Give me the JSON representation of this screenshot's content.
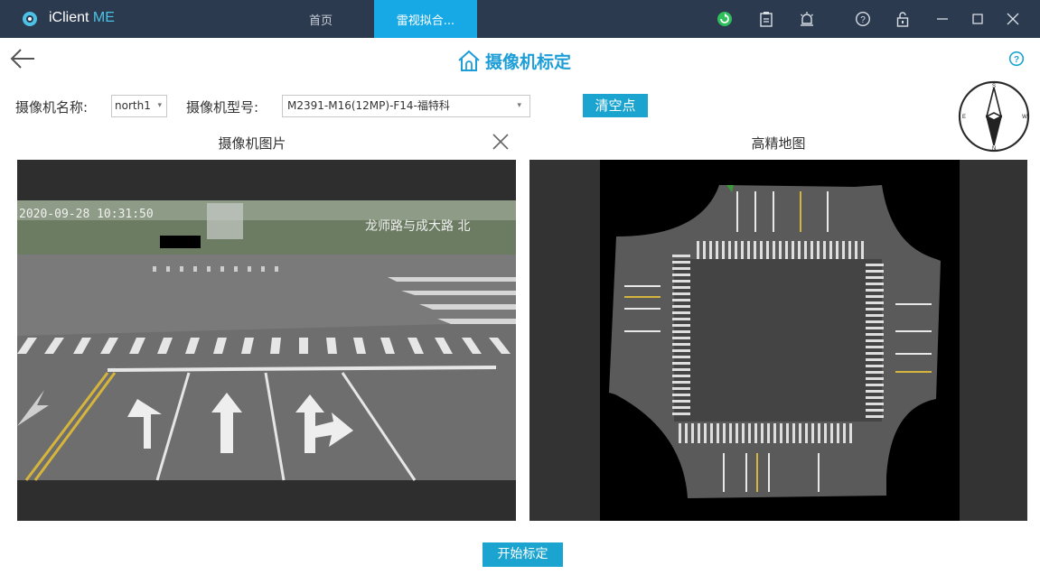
{
  "titlebar": {
    "app_name": "iClient",
    "app_name_suffix": "ME",
    "tabs": [
      {
        "label": "首页",
        "active": false
      },
      {
        "label": "雷视拟合...",
        "active": true
      }
    ],
    "icons": [
      "refresh-icon",
      "clipboard-icon",
      "alarm-icon",
      "help-icon",
      "lock-icon",
      "minimize-icon",
      "maximize-icon",
      "close-icon"
    ]
  },
  "header": {
    "title": "摄像机标定"
  },
  "form": {
    "camera_name_label": "摄像机名称:",
    "camera_name_value": "north1",
    "camera_model_label": "摄像机型号:",
    "camera_model_value": "M2391-M16(12MP)-F14-福特科",
    "clear_points_label": "清空点"
  },
  "compass": {
    "n": "N",
    "s": "S",
    "e": "E",
    "w": "W"
  },
  "panels": {
    "camera_image_title": "摄像机图片",
    "hd_map_title": "高精地图",
    "camera_overlay_time": "2020-09-28 10:31:50",
    "camera_overlay_road": "龙师路与成大路 北"
  },
  "actions": {
    "start_calibration_label": "开始标定"
  },
  "colors": {
    "titlebar_bg": "#2b3a4e",
    "active_tab": "#17a9e6",
    "accent": "#1aa4cf"
  }
}
